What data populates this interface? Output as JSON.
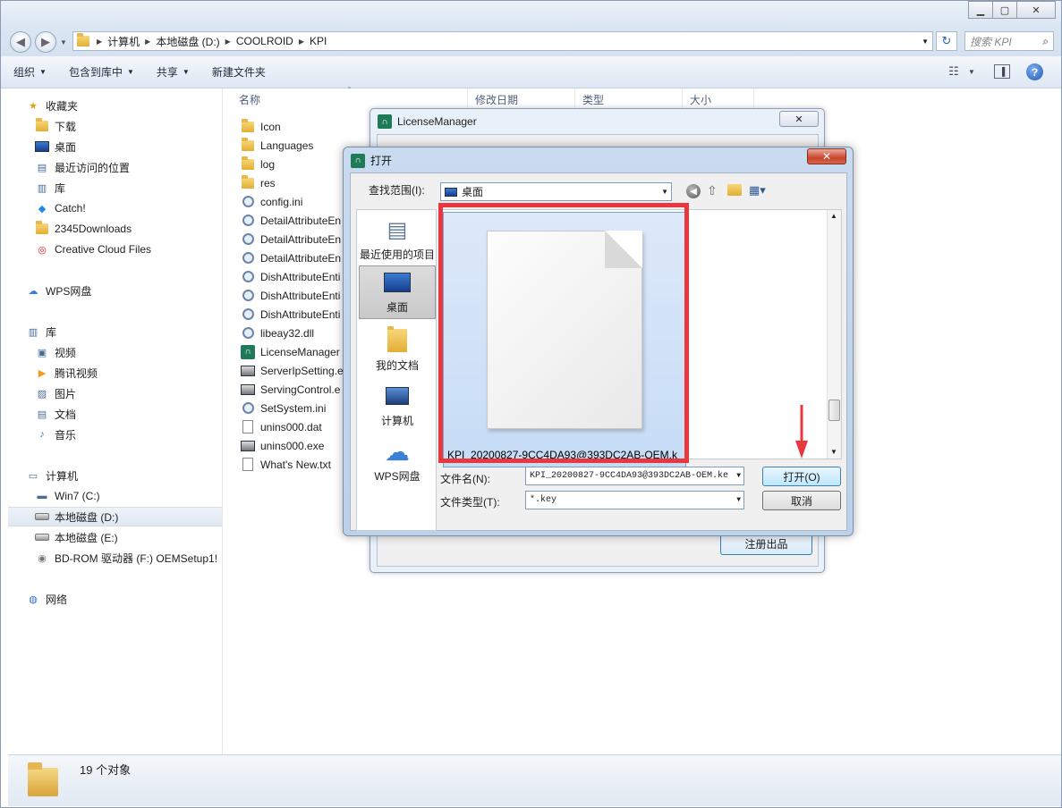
{
  "window": {
    "address": [
      "计算机",
      "本地磁盘 (D:)",
      "COOLROID",
      "KPI"
    ],
    "search_placeholder": "搜索 KPI"
  },
  "toolbar": {
    "organize": "组织",
    "include_library": "包含到库中",
    "share": "共享",
    "new_folder": "新建文件夹"
  },
  "sidebar": {
    "items": [
      {
        "label": "收藏夹",
        "icon": "star-icon",
        "indent": 0,
        "group": true
      },
      {
        "label": "下载",
        "icon": "download-folder-icon",
        "indent": 1
      },
      {
        "label": "桌面",
        "icon": "desktop-icon",
        "indent": 1
      },
      {
        "label": "最近访问的位置",
        "icon": "recent-places-icon",
        "indent": 1
      },
      {
        "label": "库",
        "icon": "library-icon",
        "indent": 1
      },
      {
        "label": "Catch!",
        "icon": "catch-icon",
        "indent": 1
      },
      {
        "label": "2345Downloads",
        "icon": "folder-icon",
        "indent": 1
      },
      {
        "label": "Creative Cloud Files",
        "icon": "creative-cloud-icon",
        "indent": 1
      },
      {
        "label": "WPS网盘",
        "icon": "cloud-icon",
        "indent": 0,
        "group": true
      },
      {
        "label": "库",
        "icon": "library-icon",
        "indent": 0,
        "group": true
      },
      {
        "label": "视频",
        "icon": "video-icon",
        "indent": 1
      },
      {
        "label": "腾讯视频",
        "icon": "tencent-video-icon",
        "indent": 1
      },
      {
        "label": "图片",
        "icon": "pictures-icon",
        "indent": 1
      },
      {
        "label": "文档",
        "icon": "documents-icon",
        "indent": 1
      },
      {
        "label": "音乐",
        "icon": "music-icon",
        "indent": 1
      },
      {
        "label": "计算机",
        "icon": "computer-icon",
        "indent": 0,
        "group": true
      },
      {
        "label": "Win7 (C:)",
        "icon": "system-drive-icon",
        "indent": 1
      },
      {
        "label": "本地磁盘 (D:)",
        "icon": "drive-icon",
        "indent": 1,
        "selected": true
      },
      {
        "label": "本地磁盘 (E:)",
        "icon": "drive-icon",
        "indent": 1
      },
      {
        "label": "BD-ROM 驱动器 (F:) OEMSetup1!",
        "icon": "disc-icon",
        "indent": 1
      },
      {
        "label": "网络",
        "icon": "network-icon",
        "indent": 0,
        "group": true
      }
    ]
  },
  "columns": {
    "name": "名称",
    "modified": "修改日期",
    "type": "类型",
    "size": "大小"
  },
  "files": [
    {
      "name": "Icon",
      "icon": "folder-icon"
    },
    {
      "name": "Languages",
      "icon": "folder-icon"
    },
    {
      "name": "log",
      "icon": "folder-icon"
    },
    {
      "name": "res",
      "icon": "folder-icon"
    },
    {
      "name": "config.ini",
      "icon": "ini-file-icon"
    },
    {
      "name": "DetailAttributeEn",
      "icon": "config-file-icon"
    },
    {
      "name": "DetailAttributeEn",
      "icon": "config-file-icon"
    },
    {
      "name": "DetailAttributeEn",
      "icon": "config-file-icon"
    },
    {
      "name": "DishAttributeEnti",
      "icon": "config-file-icon"
    },
    {
      "name": "DishAttributeEnti",
      "icon": "config-file-icon"
    },
    {
      "name": "DishAttributeEnti",
      "icon": "config-file-icon"
    },
    {
      "name": "libeay32.dll",
      "icon": "dll-file-icon"
    },
    {
      "name": "LicenseManager",
      "icon": "app-icon"
    },
    {
      "name": "ServerIpSetting.e",
      "icon": "exe-file-icon"
    },
    {
      "name": "ServingControl.e",
      "icon": "exe-file-icon"
    },
    {
      "name": "SetSystem.ini",
      "icon": "ini-file-icon"
    },
    {
      "name": "unins000.dat",
      "icon": "dat-file-icon"
    },
    {
      "name": "unins000.exe",
      "icon": "exe-file-icon"
    },
    {
      "name": "What's New.txt",
      "icon": "text-file-icon"
    }
  ],
  "status": {
    "count": "19 个对象"
  },
  "license_manager": {
    "title": "LicenseManager",
    "register_button": "注册出品"
  },
  "open_dialog": {
    "title": "打开",
    "look_in_label": "查找范围(I):",
    "look_in_value": "桌面",
    "places": [
      {
        "label": "最近使用的项目",
        "icon": "recent-items-icon"
      },
      {
        "label": "桌面",
        "icon": "desktop-icon",
        "selected": true
      },
      {
        "label": "我的文档",
        "icon": "my-documents-icon"
      },
      {
        "label": "计算机",
        "icon": "computer-icon"
      },
      {
        "label": "WPS网盘",
        "icon": "cloud-icon"
      }
    ],
    "file_item": "KPI_20200827-9CC4DA93@393DC2AB-OEM.k",
    "filename_label": "文件名(N):",
    "filename_value": "KPI_20200827-9CC4DA93@393DC2AB-OEM.ke",
    "filetype_label": "文件类型(T):",
    "filetype_value": "*.key",
    "open_button": "打开(O)",
    "cancel_button": "取消"
  },
  "colors": {
    "highlight": "#e8383d",
    "selection": "#c6dcf6"
  }
}
